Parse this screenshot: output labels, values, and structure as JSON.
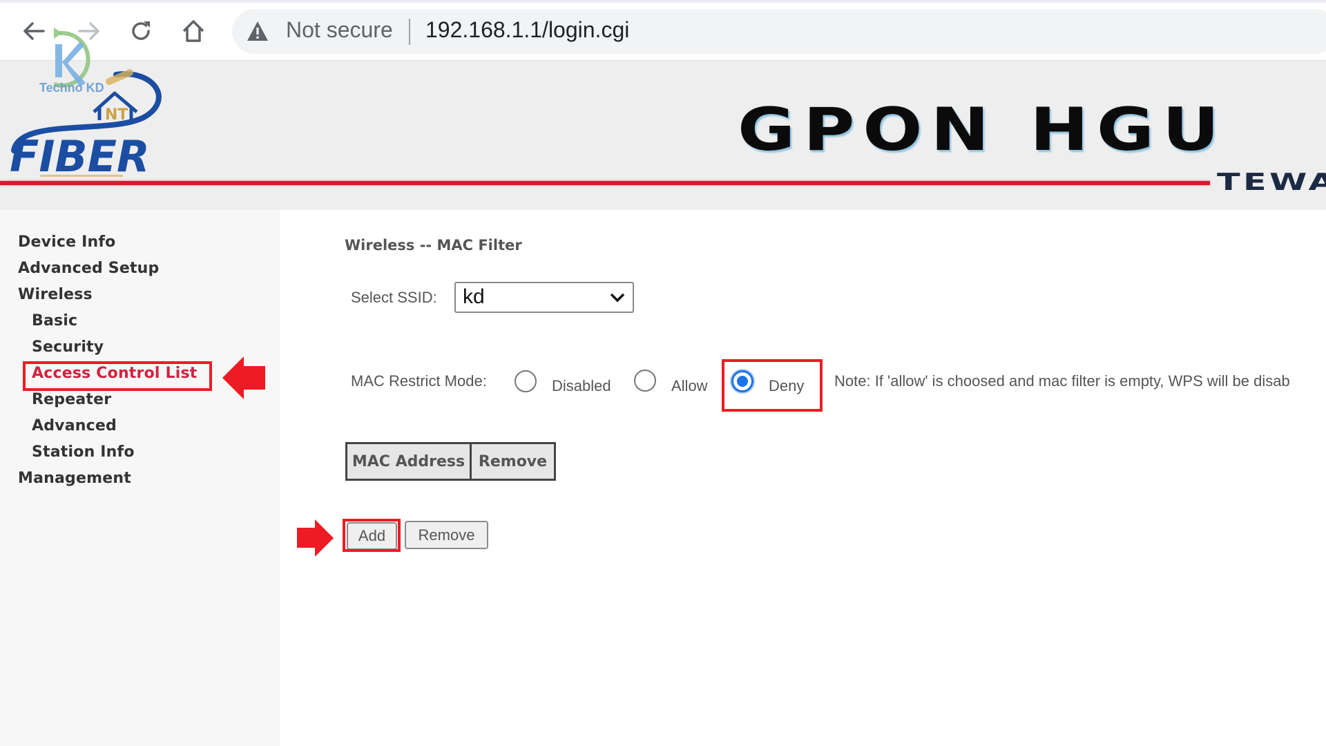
{
  "browser": {
    "security_label": "Not secure",
    "url": "192.168.1.1/login.cgi",
    "icons": {
      "back": "arrow-left-icon",
      "forward": "arrow-right-icon",
      "reload": "reload-icon",
      "home": "home-icon",
      "warning": "warning-triangle-icon"
    }
  },
  "watermark": {
    "text": "Techno KD"
  },
  "header": {
    "logo_text": "FIBER",
    "logo_badge": "NT",
    "title": "GPON HGU",
    "subtitle": "TEWA",
    "accent_color": "#d41c30"
  },
  "sidebar": {
    "items": [
      {
        "label": "Device Info",
        "level": "top"
      },
      {
        "label": "Advanced Setup",
        "level": "top"
      },
      {
        "label": "Wireless",
        "level": "top"
      },
      {
        "label": "Basic",
        "level": "sub"
      },
      {
        "label": "Security",
        "level": "sub"
      },
      {
        "label": "Access Control List",
        "level": "sub",
        "active": true
      },
      {
        "label": "Repeater",
        "level": "sub"
      },
      {
        "label": "Advanced",
        "level": "sub"
      },
      {
        "label": "Station Info",
        "level": "sub"
      },
      {
        "label": "Management",
        "level": "top"
      }
    ],
    "active_color": "#d4213d"
  },
  "content": {
    "title": "Wireless -- MAC Filter",
    "ssid_label": "Select SSID:",
    "ssid_value": "kd",
    "restrict_label": "MAC Restrict Mode:",
    "modes": [
      {
        "label": "Disabled",
        "checked": false
      },
      {
        "label": "Allow",
        "checked": false
      },
      {
        "label": "Deny",
        "checked": true
      }
    ],
    "note": "Note: If 'allow' is choosed and mac filter is empty, WPS will be disab",
    "table_headers": [
      "MAC Address",
      "Remove"
    ],
    "buttons": {
      "add": "Add",
      "remove": "Remove"
    }
  },
  "annotations": {
    "highlight_color": "#ed1c24"
  }
}
